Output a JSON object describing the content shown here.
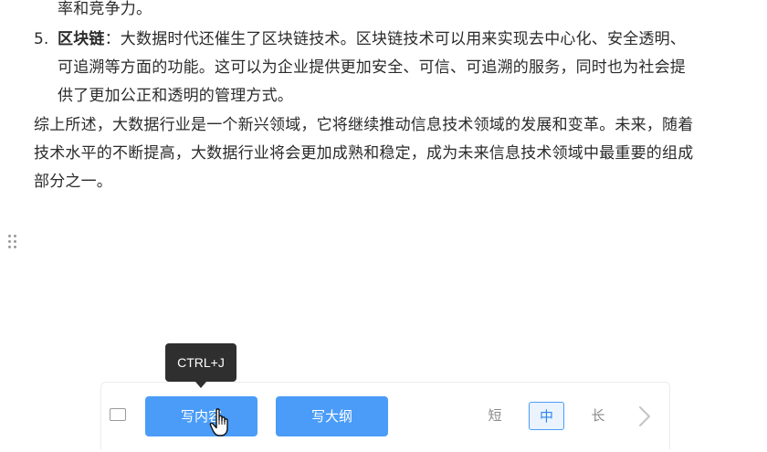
{
  "document": {
    "line0": "率和竞争力。",
    "item5": {
      "number": "5.",
      "title": "区块链",
      "line1_rest": "：大数据时代还催生了区块链技术。区块链技术可以用来实现去中心化、安全透明、",
      "line2": "可追溯等方面的功能。这可以为企业提供更加安全、可信、可追溯的服务，同时也为社会提",
      "line3": "供了更加公正和透明的管理方式。"
    },
    "summary": {
      "line1": "综上所述，大数据行业是一个新兴领域，它将继续推动信息技术领域的发展和变革。未来，随着",
      "line2": "技术水平的不断提高，大数据行业将会更加成熟和稳定，成为未来信息技术领域中最重要的组成",
      "line3": "部分之一。"
    }
  },
  "tooltip": {
    "text": "CTRL+J"
  },
  "toolbar": {
    "write_content_label": "写内容",
    "write_outline_label": "写大纲",
    "size_options": [
      "短",
      "中",
      "长"
    ],
    "selected_size": "中"
  },
  "icons": {
    "drag": "drag-handle-icon",
    "screen": "screen-icon",
    "next": "chevron-right-icon",
    "cursor": "hand-pointer-icon"
  },
  "colors": {
    "primary": "#4a9cf8",
    "selected_bg": "#eaf3fe",
    "text": "#2b2b2b",
    "tooltip_bg": "#2f2f2f"
  }
}
